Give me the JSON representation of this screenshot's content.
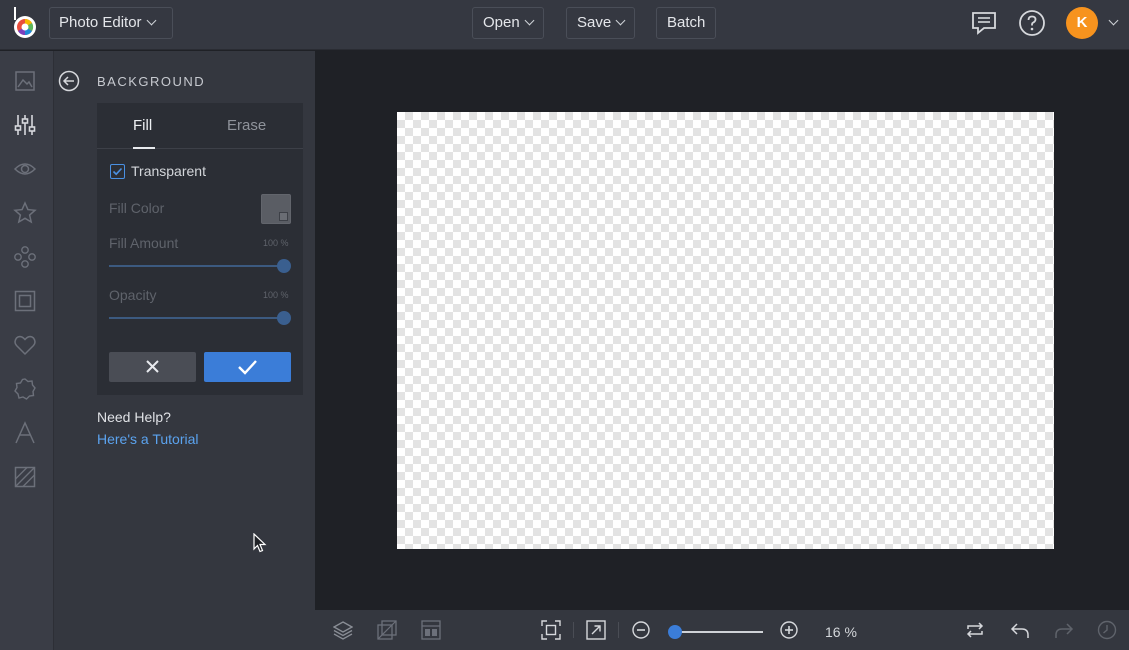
{
  "header": {
    "app_name": "Photo Editor",
    "open_label": "Open",
    "save_label": "Save",
    "batch_label": "Batch",
    "avatar_initial": "K",
    "avatar_color": "#f7931e"
  },
  "sidebar": {
    "items": [
      {
        "name": "image-icon"
      },
      {
        "name": "sliders-icon",
        "active": true
      },
      {
        "name": "eye-icon"
      },
      {
        "name": "star-icon"
      },
      {
        "name": "circles-icon"
      },
      {
        "name": "frame-icon"
      },
      {
        "name": "heart-icon"
      },
      {
        "name": "badge-icon"
      },
      {
        "name": "text-icon"
      },
      {
        "name": "texture-icon"
      }
    ]
  },
  "panel": {
    "title": "BACKGROUND",
    "tabs": [
      {
        "label": "Fill",
        "active": true
      },
      {
        "label": "Erase",
        "active": false
      }
    ],
    "transparent_label": "Transparent",
    "transparent_checked": true,
    "fill_color_label": "Fill Color",
    "fill_amount_label": "Fill Amount",
    "fill_amount_value": "100 %",
    "opacity_label": "Opacity",
    "opacity_value": "100 %",
    "help_title": "Need Help?",
    "help_link": "Here's a Tutorial"
  },
  "footer": {
    "zoom_value": "16 %",
    "zoom_fraction": 0.0
  },
  "colors": {
    "accent": "#3b7dd8",
    "link": "#5ba3ef"
  }
}
